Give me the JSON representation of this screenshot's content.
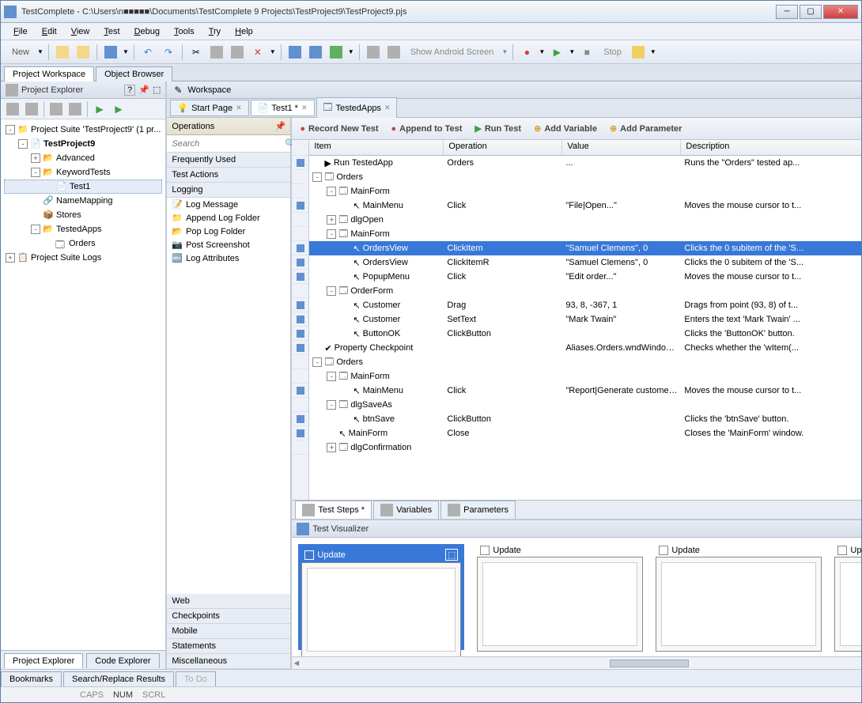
{
  "title": "TestComplete - C:\\Users\\n■■■■■\\Documents\\TestComplete 9 Projects\\TestProject9\\TestProject9.pjs",
  "menu": [
    "File",
    "Edit",
    "View",
    "Test",
    "Debug",
    "Tools",
    "Try",
    "Help"
  ],
  "toolbar": {
    "new": "New",
    "show_android": "Show Android Screen",
    "stop": "Stop"
  },
  "top_tabs": [
    "Project Workspace",
    "Object Browser"
  ],
  "project_explorer": {
    "title": "Project Explorer",
    "tree": [
      {
        "indent": 0,
        "toggle": "-",
        "icon": "📁",
        "label": "Project Suite 'TestProject9' (1 pr..."
      },
      {
        "indent": 1,
        "toggle": "-",
        "icon": "📄",
        "label": "TestProject9",
        "bold": true
      },
      {
        "indent": 2,
        "toggle": "+",
        "icon": "📂",
        "label": "Advanced"
      },
      {
        "indent": 2,
        "toggle": "-",
        "icon": "📂",
        "label": "KeywordTests"
      },
      {
        "indent": 3,
        "toggle": "",
        "icon": "📄",
        "label": "Test1",
        "selected": true
      },
      {
        "indent": 2,
        "toggle": "",
        "icon": "🔗",
        "label": "NameMapping"
      },
      {
        "indent": 2,
        "toggle": "",
        "icon": "📦",
        "label": "Stores"
      },
      {
        "indent": 2,
        "toggle": "-",
        "icon": "📂",
        "label": "TestedApps"
      },
      {
        "indent": 3,
        "toggle": "",
        "icon": "🗔",
        "label": "Orders"
      },
      {
        "indent": 0,
        "toggle": "+",
        "icon": "📋",
        "label": "Project Suite Logs"
      }
    ]
  },
  "left_bottom_tabs": [
    "Project Explorer",
    "Code Explorer"
  ],
  "workspace": {
    "title": "Workspace",
    "tabs": [
      {
        "icon": "💡",
        "label": "Start Page",
        "close": true
      },
      {
        "icon": "📄",
        "label": "Test1 *",
        "close": true,
        "active": true
      },
      {
        "icon": "🗔",
        "label": "TestedApps",
        "close": true
      }
    ]
  },
  "operations": {
    "title": "Operations",
    "search_placeholder": "Search",
    "cats_top": [
      "Frequently Used",
      "Test Actions",
      "Logging"
    ],
    "items": [
      {
        "icon": "📝",
        "label": "Log Message"
      },
      {
        "icon": "📁",
        "label": "Append Log Folder"
      },
      {
        "icon": "📂",
        "label": "Pop Log Folder"
      },
      {
        "icon": "📷",
        "label": "Post Screenshot"
      },
      {
        "icon": "🔤",
        "label": "Log Attributes"
      }
    ],
    "cats_bottom": [
      "Web",
      "Checkpoints",
      "Mobile",
      "Statements",
      "Miscellaneous"
    ]
  },
  "test_toolbar": [
    "Record New Test",
    "Append to Test",
    "Run Test",
    "Add Variable",
    "Add Parameter"
  ],
  "grid": {
    "headers": [
      "Item",
      "Operation",
      "Value",
      "Description"
    ],
    "rows": [
      {
        "indent": 0,
        "toggle": "",
        "icon": "▶",
        "item": "Run TestedApp",
        "op": "Orders",
        "val": "...",
        "desc": "Runs the \"Orders\" tested ap...",
        "gutter": true
      },
      {
        "indent": 0,
        "toggle": "-",
        "icon": "🗔",
        "item": "Orders",
        "op": "",
        "val": "",
        "desc": ""
      },
      {
        "indent": 1,
        "toggle": "-",
        "icon": "🗔",
        "item": "MainForm",
        "op": "",
        "val": "",
        "desc": ""
      },
      {
        "indent": 2,
        "toggle": "",
        "icon": "↖",
        "item": "MainMenu",
        "op": "Click",
        "val": "\"File|Open...\"",
        "desc": "Moves the mouse cursor to t...",
        "gutter": true
      },
      {
        "indent": 1,
        "toggle": "+",
        "icon": "🗔",
        "item": "dlgOpen",
        "op": "",
        "val": "",
        "desc": ""
      },
      {
        "indent": 1,
        "toggle": "-",
        "icon": "🗔",
        "item": "MainForm",
        "op": "",
        "val": "",
        "desc": ""
      },
      {
        "indent": 2,
        "toggle": "",
        "icon": "↖",
        "item": "OrdersView",
        "op": "ClickItem",
        "val": "\"Samuel Clemens\", 0",
        "desc": "Clicks the 0 subitem of the 'S...",
        "selected": true,
        "gutter": true
      },
      {
        "indent": 2,
        "toggle": "",
        "icon": "↖",
        "item": "OrdersView",
        "op": "ClickItemR",
        "val": "\"Samuel Clemens\", 0",
        "desc": "Clicks the 0 subitem of the 'S...",
        "gutter": true
      },
      {
        "indent": 2,
        "toggle": "",
        "icon": "↖",
        "item": "PopupMenu",
        "op": "Click",
        "val": "\"Edit order...\"",
        "desc": "Moves the mouse cursor to t...",
        "gutter": true
      },
      {
        "indent": 1,
        "toggle": "-",
        "icon": "🗔",
        "item": "OrderForm",
        "op": "",
        "val": "",
        "desc": ""
      },
      {
        "indent": 2,
        "toggle": "",
        "icon": "↖",
        "item": "Customer",
        "op": "Drag",
        "val": "93, 8, -367, 1",
        "desc": "Drags from point (93, 8) of t...",
        "gutter": true
      },
      {
        "indent": 2,
        "toggle": "",
        "icon": "↖",
        "item": "Customer",
        "op": "SetText",
        "val": "\"Mark Twain\"",
        "desc": "Enters the text 'Mark Twain' ...",
        "gutter": true
      },
      {
        "indent": 2,
        "toggle": "",
        "icon": "↖",
        "item": "ButtonOK",
        "op": "ClickButton",
        "val": "",
        "desc": "Clicks the 'ButtonOK' button.",
        "gutter": true
      },
      {
        "indent": 0,
        "toggle": "",
        "icon": "✔",
        "item": "Property Checkpoint",
        "op": "",
        "val": "Aliases.Orders.wndWindow...",
        "desc": "Checks whether the 'wItem(...",
        "gutter": true
      },
      {
        "indent": 0,
        "toggle": "-",
        "icon": "🗔",
        "item": "Orders",
        "op": "",
        "val": "",
        "desc": ""
      },
      {
        "indent": 1,
        "toggle": "-",
        "icon": "🗔",
        "item": "MainForm",
        "op": "",
        "val": "",
        "desc": ""
      },
      {
        "indent": 2,
        "toggle": "",
        "icon": "↖",
        "item": "MainMenu",
        "op": "Click",
        "val": "\"Report|Generate customer ...",
        "desc": "Moves the mouse cursor to t...",
        "gutter": true
      },
      {
        "indent": 1,
        "toggle": "-",
        "icon": "🗔",
        "item": "dlgSaveAs",
        "op": "",
        "val": "",
        "desc": ""
      },
      {
        "indent": 2,
        "toggle": "",
        "icon": "↖",
        "item": "btnSave",
        "op": "ClickButton",
        "val": "",
        "desc": "Clicks the 'btnSave' button.",
        "gutter": true
      },
      {
        "indent": 1,
        "toggle": "",
        "icon": "↖",
        "item": "MainForm",
        "op": "Close",
        "val": "",
        "desc": "Closes the 'MainForm' window.",
        "gutter": true
      },
      {
        "indent": 1,
        "toggle": "+",
        "icon": "🗔",
        "item": "dlgConfirmation",
        "op": "",
        "val": "",
        "desc": ""
      }
    ]
  },
  "bottom_editor_tabs": [
    "Test Steps *",
    "Variables",
    "Parameters"
  ],
  "visualizer": {
    "title": "Test Visualizer",
    "cards": [
      "Update",
      "Update",
      "Update",
      "Update"
    ]
  },
  "bottom_tabs": [
    "Bookmarks",
    "Search/Replace Results",
    "To Do"
  ],
  "status": [
    "CAPS",
    "NUM",
    "SCRL"
  ]
}
